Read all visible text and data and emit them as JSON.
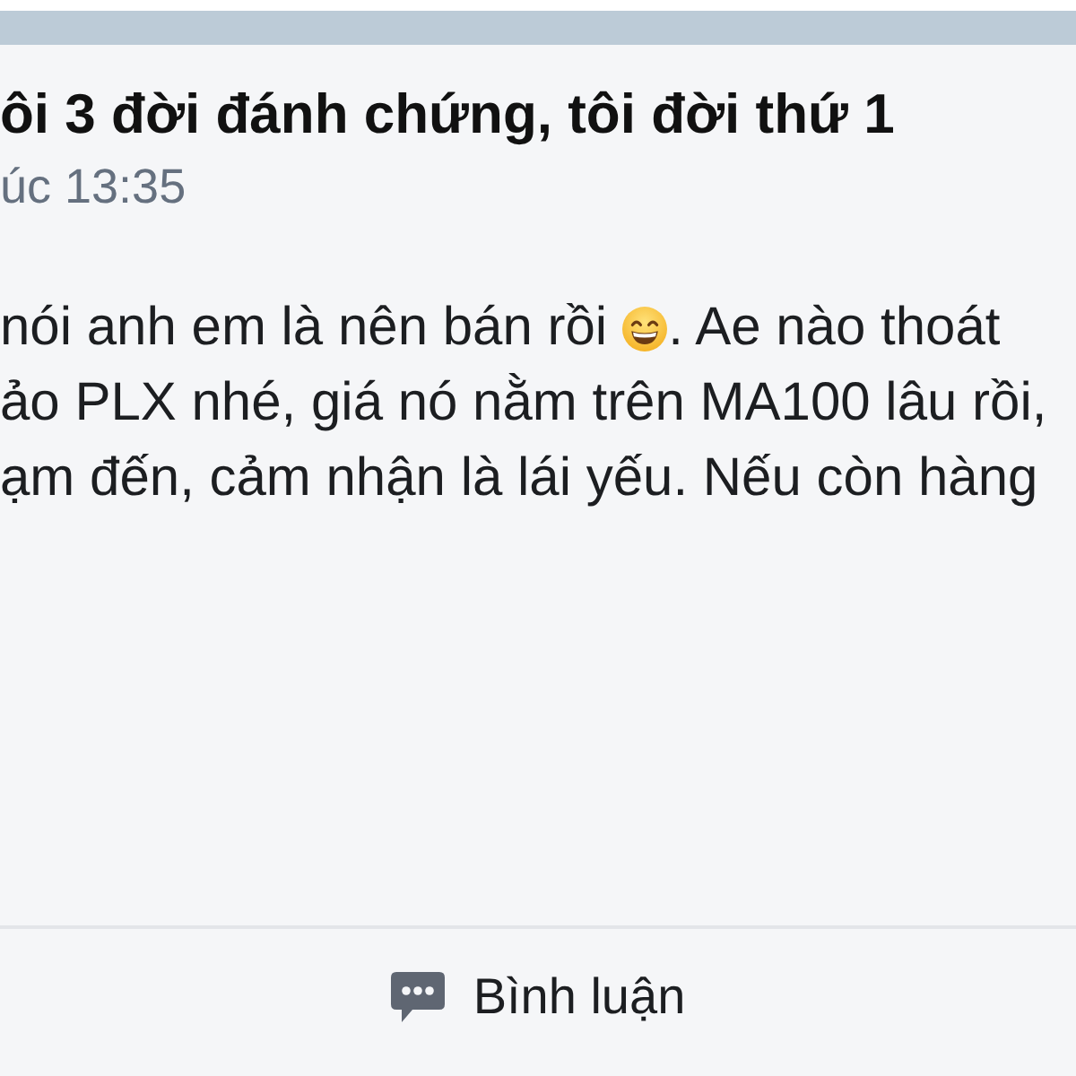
{
  "post": {
    "title": "ôi 3 đời đánh chứng, tôi đời thứ 1",
    "time": "úc 13:35",
    "body_lines": [
      {
        "segments": [
          {
            "kind": "text",
            "text": "nói anh em là nên bán rồi"
          },
          {
            "kind": "emoji"
          },
          {
            "kind": "text",
            "text": ". Ae nào thoát"
          }
        ]
      },
      {
        "segments": [
          {
            "kind": "text",
            "text": "ảo PLX nhé, giá nó nằm trên MA100 lâu rồi,"
          }
        ]
      },
      {
        "segments": [
          {
            "kind": "text",
            "text": "ạm đến, cảm nhận là lái yếu. Nếu còn hàng"
          }
        ]
      }
    ]
  },
  "actions": [
    {
      "kind": "comment",
      "label": "Bình luận"
    }
  ]
}
